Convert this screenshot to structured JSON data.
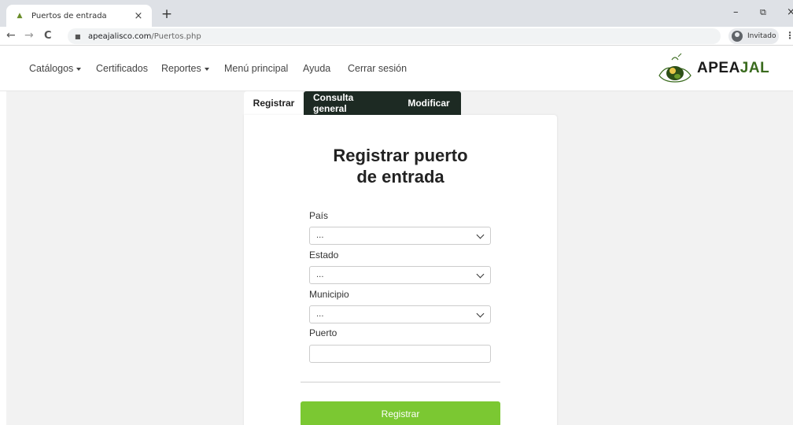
{
  "browser": {
    "tab_title": "Puertos de entrada",
    "tab_close": "×",
    "new_tab": "+",
    "url_domain": "apeajalisco.com",
    "url_path": "/Puertos.php",
    "profile_label": "Invitado"
  },
  "navbar": {
    "items": [
      {
        "label": "Catálogos",
        "dropdown": true
      },
      {
        "label": "Certificados",
        "dropdown": false
      },
      {
        "label": "Reportes",
        "dropdown": true
      },
      {
        "label": "Menú principal",
        "dropdown": false
      },
      {
        "label": "Ayuda",
        "dropdown": false
      },
      {
        "label": "Cerrar sesión",
        "dropdown": false
      }
    ],
    "logo_text_a": "APEA",
    "logo_text_b": "JAL"
  },
  "tabs": [
    {
      "label": "Registrar",
      "active": true
    },
    {
      "label": "Consulta general",
      "active": false
    },
    {
      "label": "Modificar",
      "active": false
    }
  ],
  "form": {
    "title_line1": "Registrar puerto",
    "title_line2": "de entrada",
    "fields": [
      {
        "label": "País",
        "type": "select",
        "value": "..."
      },
      {
        "label": "Estado",
        "type": "select",
        "value": "..."
      },
      {
        "label": "Municipio",
        "type": "select",
        "value": "..."
      },
      {
        "label": "Puerto",
        "type": "text",
        "value": ""
      }
    ],
    "submit_label": "Registrar"
  },
  "colors": {
    "nav_dark": "#1d2a23",
    "submit_green": "#7bc832",
    "brand_green": "#3a6b1e"
  }
}
